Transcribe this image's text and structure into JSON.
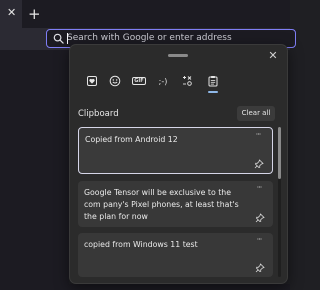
{
  "browser": {
    "tab_close_glyph": "✕",
    "new_tab_glyph": "+",
    "address_placeholder": "Search with Google or enter address"
  },
  "panel": {
    "close_glyph": "✕",
    "categories": [
      {
        "name": "heart-icon"
      },
      {
        "name": "smiley-icon"
      },
      {
        "name": "gif-icon",
        "label": "GIF"
      },
      {
        "name": "kaomoji-icon",
        "label": ";-)"
      },
      {
        "name": "symbols-icon"
      },
      {
        "name": "clipboard-icon"
      }
    ],
    "active_category": "clipboard-icon",
    "section_title": "Clipboard",
    "clear_all_label": "Clear all",
    "more_glyph": "···",
    "items": [
      {
        "text": "Copied from Android 12",
        "selected": true
      },
      {
        "text": "Google Tensor will be exclusive to the com pany's Pixel phones, at least that's the plan for now",
        "selected": false
      },
      {
        "text": "copied from Windows 11 test",
        "selected": false
      }
    ]
  },
  "colors": {
    "accent": "#7f7ef5",
    "panel_bg": "#2b2b2b",
    "item_bg": "#383838"
  }
}
